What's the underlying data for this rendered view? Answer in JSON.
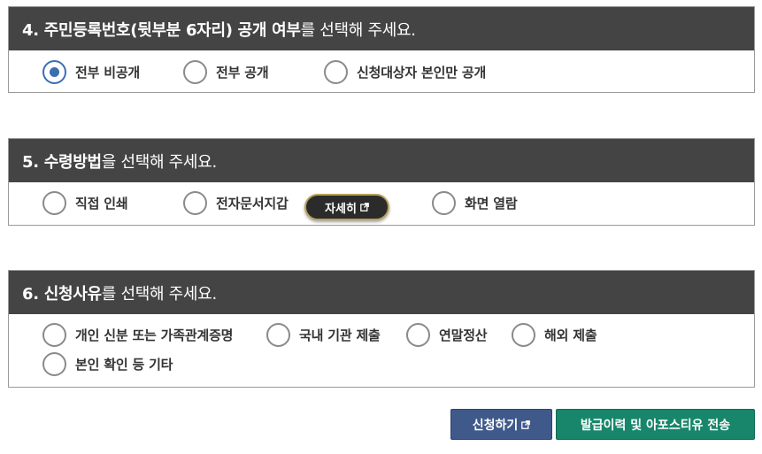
{
  "section4": {
    "title_bold": "4. 주민등록번호(뒷부분 6자리) 공개 여부",
    "title_rest": "를 선택해 주세요.",
    "options": [
      {
        "label": "전부 비공개",
        "checked": true
      },
      {
        "label": "전부 공개",
        "checked": false
      },
      {
        "label": "신청대상자 본인만 공개",
        "checked": false
      }
    ]
  },
  "section5": {
    "title_bold": "5. 수령방법",
    "title_rest": "을 선택해 주세요.",
    "options": [
      {
        "label": "직접 인쇄",
        "checked": false
      },
      {
        "label": "전자문서지갑",
        "checked": false
      },
      {
        "label": "화면 열람",
        "checked": false
      }
    ],
    "detail_button": "자세히"
  },
  "section6": {
    "title_bold": "6. 신청사유",
    "title_rest": "를 선택해 주세요.",
    "options": [
      {
        "label": "개인 신분 또는 가족관계증명",
        "checked": false
      },
      {
        "label": "국내 기관 제출",
        "checked": false
      },
      {
        "label": "연말정산",
        "checked": false
      },
      {
        "label": "해외 제출",
        "checked": false
      },
      {
        "label": "본인 확인 등 기타",
        "checked": false
      }
    ]
  },
  "actions": {
    "apply": "신청하기",
    "history": "발급이력 및 아포스티유 전송"
  },
  "icons": {
    "external_link": "external-link-icon"
  },
  "colors": {
    "header_bg": "#444444",
    "radio_checked": "#3a6fb0",
    "apply_btn": "#3f5a8a",
    "history_btn": "#17866a"
  }
}
